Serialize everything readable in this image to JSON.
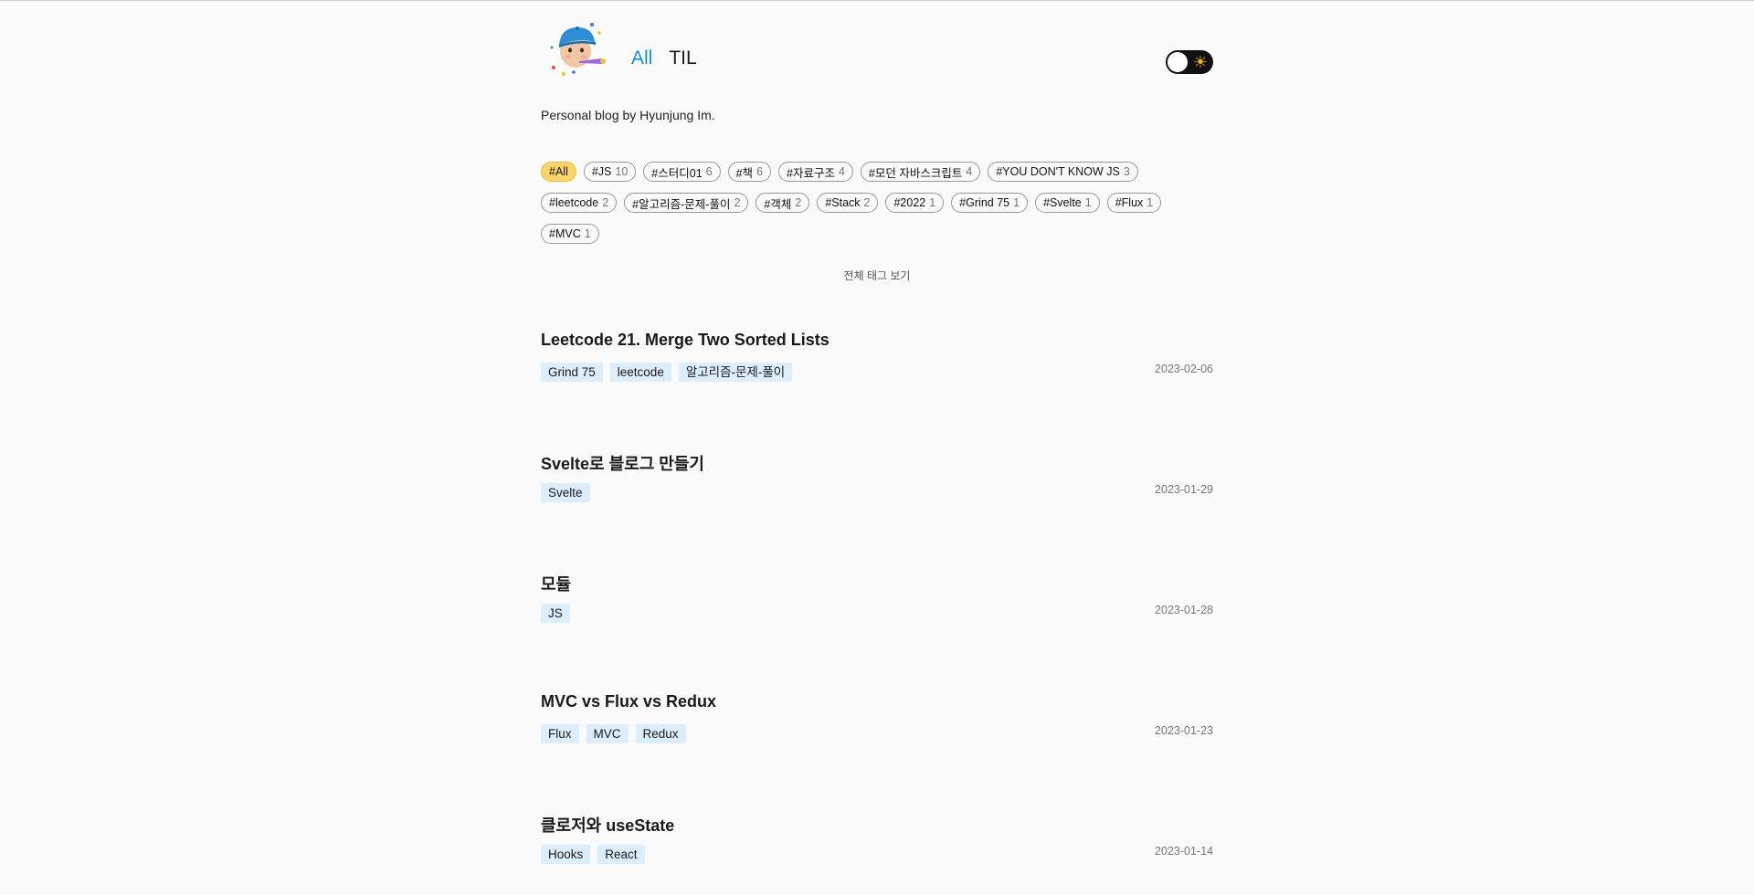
{
  "header": {
    "avatar_icon": "memoji-party-avatar-icon",
    "nav": [
      {
        "label": "All",
        "active": true
      },
      {
        "label": "TIL",
        "active": false
      }
    ],
    "theme_toggle_icon": "sun-icon",
    "theme_toggle_symbol": "☀"
  },
  "bio": "Personal blog by Hyunjung Im.",
  "tags": [
    {
      "name": "#All",
      "count": "",
      "selected": true
    },
    {
      "name": "#JS",
      "count": "10",
      "selected": false
    },
    {
      "name": "#스터디01",
      "count": "6",
      "selected": false
    },
    {
      "name": "#책",
      "count": "6",
      "selected": false
    },
    {
      "name": "#자료구조",
      "count": "4",
      "selected": false
    },
    {
      "name": "#모던 자바스크립트",
      "count": "4",
      "selected": false
    },
    {
      "name": "#YOU DON'T KNOW JS",
      "count": "3",
      "selected": false
    },
    {
      "name": "#leetcode",
      "count": "2",
      "selected": false
    },
    {
      "name": "#알고리즘-문제-풀이",
      "count": "2",
      "selected": false
    },
    {
      "name": "#객체",
      "count": "2",
      "selected": false
    },
    {
      "name": "#Stack",
      "count": "2",
      "selected": false
    },
    {
      "name": "#2022",
      "count": "1",
      "selected": false
    },
    {
      "name": "#Grind 75",
      "count": "1",
      "selected": false
    },
    {
      "name": "#Svelte",
      "count": "1",
      "selected": false
    },
    {
      "name": "#Flux",
      "count": "1",
      "selected": false
    },
    {
      "name": "#MVC",
      "count": "1",
      "selected": false
    }
  ],
  "all_tags_link": "전체 태그 보기",
  "posts": [
    {
      "title": "Leetcode 21. Merge Two Sorted Lists",
      "tags": [
        "Grind 75",
        "leetcode",
        "알고리즘-문제-풀이"
      ],
      "date": "2023-02-06"
    },
    {
      "title": "Svelte로 블로그 만들기",
      "tags": [
        "Svelte"
      ],
      "date": "2023-01-29"
    },
    {
      "title": "모듈",
      "tags": [
        "JS"
      ],
      "date": "2023-01-28"
    },
    {
      "title": "MVC vs Flux vs Redux",
      "tags": [
        "Flux",
        "MVC",
        "Redux"
      ],
      "date": "2023-01-23"
    },
    {
      "title": "클로저와 useState",
      "tags": [
        "Hooks",
        "React"
      ],
      "date": "2023-01-14"
    }
  ],
  "colors": {
    "accent": "#1a8fd6",
    "selected_tag": "#fcd56a",
    "chip_bg": "#dceefb",
    "background": "#fafafa"
  }
}
